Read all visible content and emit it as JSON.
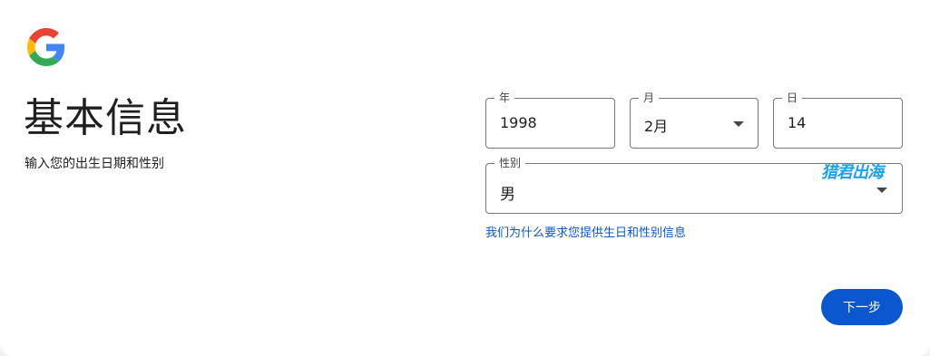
{
  "header": {
    "logo_icon": "google-g-logo-icon",
    "title": "基本信息",
    "subtitle": "输入您的出生日期和性别"
  },
  "form": {
    "year": {
      "label": "年",
      "value": "1998"
    },
    "month": {
      "label": "月",
      "value": "2月",
      "icon": "chevron-down-icon"
    },
    "day": {
      "label": "日",
      "value": "14"
    },
    "gender": {
      "label": "性别",
      "value": "男",
      "icon": "chevron-down-icon"
    },
    "info_link": "我们为什么要求您提供生日和性别信息"
  },
  "watermark": {
    "text": "猎君出海"
  },
  "actions": {
    "next_label": "下一步"
  },
  "colors": {
    "accent": "#0b57d0",
    "watermark": "#1aa3e8",
    "border": "#747775",
    "text": "#1f1f1f"
  }
}
